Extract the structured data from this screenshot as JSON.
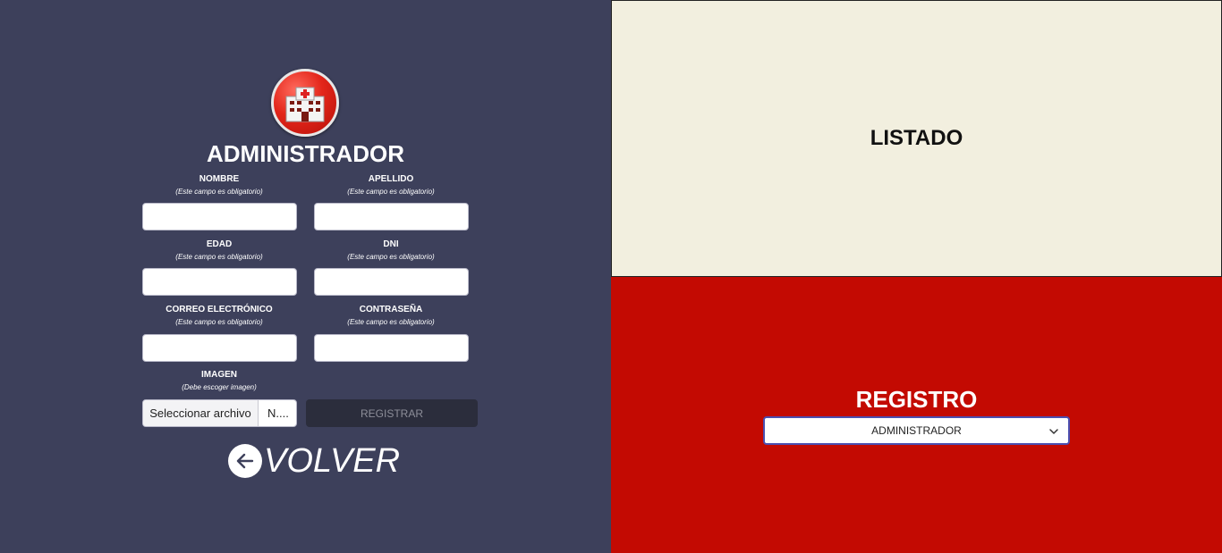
{
  "admin_form": {
    "title": "ADMINISTRADOR",
    "fields": [
      {
        "label": "NOMBRE",
        "hint": "(Este campo es obligatorio)",
        "value": ""
      },
      {
        "label": "APELLIDO",
        "hint": "(Este campo es obligatorio)",
        "value": ""
      },
      {
        "label": "EDAD",
        "hint": "(Este campo es obligatorio)",
        "value": ""
      },
      {
        "label": "DNI",
        "hint": "(Este campo es obligatorio)",
        "value": ""
      },
      {
        "label": "CORREO ELECTRÓNICO",
        "hint": "(Este campo es obligatorio)",
        "value": ""
      },
      {
        "label": "CONTRASEÑA",
        "hint": "(Este campo es obligatorio)",
        "value": ""
      }
    ],
    "image": {
      "label": "IMAGEN",
      "hint": "(Debe escoger imagen)",
      "button_label": "Seleccionar archivo",
      "file_name": "N...."
    },
    "register_label": "REGISTRAR",
    "back_label": "VOLVER"
  },
  "listado": {
    "title": "LISTADO"
  },
  "registro": {
    "title": "REGISTRO",
    "selected": "ADMINISTRADOR"
  },
  "icons": {
    "logo": "hospital-icon",
    "back": "arrow-left-icon",
    "dropdown": "chevron-down-icon"
  },
  "colors": {
    "left_bg": "#3d405b",
    "listado_bg": "#f2efdf",
    "registro_bg": "#c30a02",
    "logo_red": "#e3261a"
  }
}
